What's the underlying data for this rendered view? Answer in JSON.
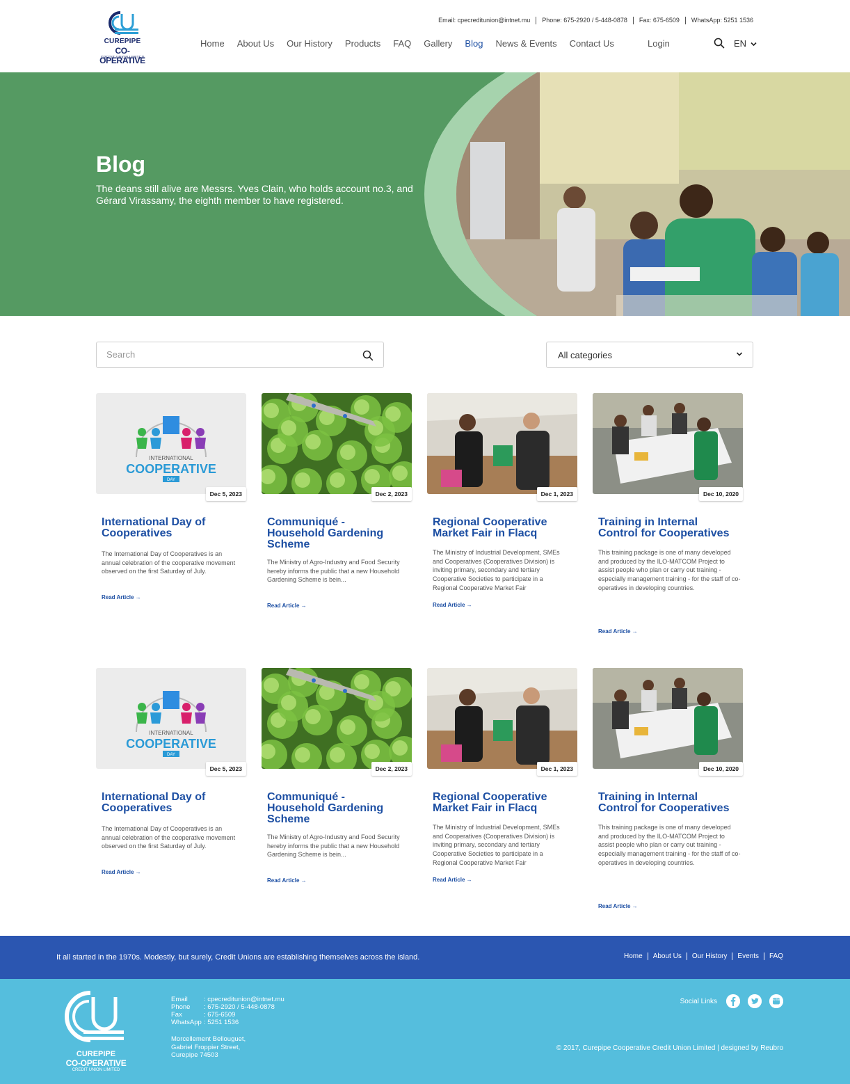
{
  "header": {
    "logo": {
      "line1": "CUREPIPE",
      "line2": "CO-OPERATIVE",
      "line3": "CREDIT UNION LIMITED"
    },
    "contact": {
      "email": "Email: cpecreditunion@intnet.mu",
      "phone": "Phone: 675-2920 / 5-448-0878",
      "fax": "Fax: 675-6509",
      "whatsapp": "WhatsApp: 5251 1536"
    },
    "nav": [
      "Home",
      "About Us",
      "Our History",
      "Products",
      "FAQ",
      "Gallery",
      "Blog",
      "News & Events",
      "Contact Us"
    ],
    "active_nav": "Blog",
    "login": "Login",
    "lang": "EN"
  },
  "hero": {
    "title": "Blog",
    "subtitle": "The deans still alive are Messrs. Yves Clain, who holds account no.3, and Gérard Virassamy, the eighth member to have registered."
  },
  "filters": {
    "search_placeholder": "Search",
    "category_selected": "All categories"
  },
  "read_label": "Read Article →",
  "posts": [
    {
      "date": "Dec 5, 2023",
      "title": "International Day of Cooperatives",
      "desc": "The International Day of Cooperatives is an annual celebration of the cooperative movement observed on the first Saturday of July.",
      "img": "cooperative-day",
      "img_label1": "INTERNATIONAL",
      "img_label2": "COOPERATIVE",
      "img_label3": "DAY"
    },
    {
      "date": "Dec 2, 2023",
      "title": "Communiqué - Household Gardening Scheme",
      "desc": "The Ministry of Agro-Industry and Food Security hereby informs the public that a new Household Gardening Scheme is bein...",
      "img": "lettuce"
    },
    {
      "date": "Dec 1, 2023",
      "title": "Regional Cooperative Market Fair in Flacq",
      "desc": "The Ministry of Industrial Development, SMEs and Cooperatives (Cooperatives Division) is inviting primary, secondary and tertiary Cooperative Societies to participate in a Regional Cooperative Market Fair",
      "img": "market"
    },
    {
      "date": "Dec 10, 2020",
      "title": "Training in Internal Control for Cooperatives",
      "desc": "This training package is one of many developed and produced by the ILO-MATCOM Project to assist people who plan or carry out training - especially management training - for the staff of co-operatives in developing countries.",
      "img": "training"
    },
    {
      "date": "Dec 5, 2023",
      "title": "International Day of Cooperatives",
      "desc": "The International Day of Cooperatives is an annual celebration of the cooperative movement observed on the first Saturday of July.",
      "img": "cooperative-day",
      "img_label1": "INTERNATIONAL",
      "img_label2": "COOPERATIVE",
      "img_label3": "DAY"
    },
    {
      "date": "Dec 2, 2023",
      "title": "Communiqué - Household Gardening Scheme",
      "desc": "The Ministry of Agro-Industry and Food Security hereby informs the public that a new Household Gardening Scheme is bein...",
      "img": "lettuce"
    },
    {
      "date": "Dec 1, 2023",
      "title": "Regional Cooperative Market Fair in Flacq",
      "desc": "The Ministry of Industrial Development, SMEs and Cooperatives (Cooperatives Division) is inviting primary, secondary and tertiary Cooperative Societies to participate in a Regional Cooperative Market Fair",
      "img": "market"
    },
    {
      "date": "Dec 10, 2020",
      "title": "Training in Internal Control for Cooperatives",
      "desc": "This training package is one of many developed and produced by the ILO-MATCOM Project to assist people who plan or carry out training - especially management training - for the staff of co-operatives in developing countries.",
      "img": "training"
    }
  ],
  "footer": {
    "tagline": "It all started in the 1970s. Modestly, but surely, Credit Unions are establishing themselves across the island.",
    "links": [
      "Home",
      "About Us",
      "Our History",
      "Events",
      "FAQ"
    ],
    "logo": {
      "line1": "CUREPIPE",
      "line2": "CO-OPERATIVE",
      "line3": "CREDIT UNION LIMITED"
    },
    "info": [
      {
        "k": "Email",
        "v": ": cpecreditunion@intnet.mu"
      },
      {
        "k": "Phone",
        "v": ": 675-2920 / 5-448-0878"
      },
      {
        "k": "Fax",
        "v": ": 675-6509"
      },
      {
        "k": "WhatsApp",
        "v": ": 5251 1536"
      }
    ],
    "address": [
      "Morcellement Bellouguet,",
      "Gabriel Froppier Street,",
      "Curepipe 74503"
    ],
    "social_label": "Social Links",
    "social_icons": [
      "facebook-icon",
      "twitter-icon",
      "youtube-icon"
    ],
    "youtube_text": "You Tube",
    "copyright": "© 2017, Curepipe Cooperative Credit Union Limited | designed by Reubro"
  },
  "colors": {
    "brand_blue": "#1d4fa3",
    "hero_green": "#559a62",
    "footer_blue": "#2b56b1",
    "footer_cyan": "#55bedd"
  }
}
